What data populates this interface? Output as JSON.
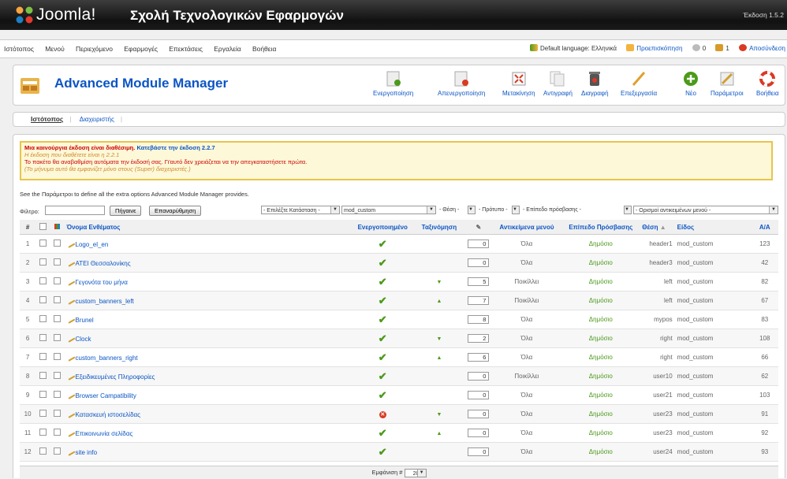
{
  "header": {
    "brand": "Joomla!",
    "site_name": "Σχολή Τεχνολογικών Εφαρμογών",
    "version": "Έκδοση 1.5.2"
  },
  "menubar": [
    "Ιστότοπος",
    "Μενού",
    "Περιεχόμενο",
    "Εφαρμογές",
    "Επεκτάσεις",
    "Εργαλεία",
    "Βοήθεια"
  ],
  "status": {
    "language": "Default language: Ελληνικά",
    "preview": "Προεπισκόπηση",
    "messages": "0",
    "users": "1",
    "logout": "Αποσύνδεση"
  },
  "page_title": "Advanced Module Manager",
  "toolbar": [
    "Ενεργοποίηση",
    "Απενεργοποίηση",
    "Μετακίνηση",
    "Αντιγραφή",
    "Διαγραφή",
    "Επεξεργασία",
    "Νέο",
    "Παράμετροι",
    "Βοήθεια"
  ],
  "submenu": [
    "Ιστότοπος",
    "Διαχειριστής"
  ],
  "notice": {
    "line1a": "Μια καινούργια έκδοση είναι διαθέσιμη.",
    "line1b": "Κατεβάστε την έκδοση 2.2.7",
    "line2": "Η έκδοση που διαθέτετε είναι η 2.2.1",
    "line3": "Το πακέτο θα αναβαθμίση αυτόματα την έκδοσή σας. Γι'αυτό δεν χρειάζεται να την απεγκαταστήσετε πρώτα.",
    "line4": "(Το μήνυμα αυτό θα εμφανίζετ μόνο στους (Super) διαχειριστές.)"
  },
  "intro": "See the Παράμετροι to define all the extra options Advanced Module Manager provides.",
  "filter": {
    "label": "Φίλτρο:",
    "go": "Πήγαινε",
    "reset": "Επαναρύθμηση",
    "state": "- Επιλέξτε Κατάσταση -",
    "type": "mod_custom",
    "position": "- Θέση -",
    "template": "- Πρότυπο -",
    "access": "- Επίπεδο πρόσβασης -",
    "menu": "- Ορισμοί αντικειμένων μενού -"
  },
  "columns": {
    "num": "#",
    "name": "Όνομα Ενθέματος",
    "enabled": "Ενεργοποιημένο",
    "order": "Ταξινόμηση",
    "menu": "Αντικείμενα μενού",
    "access": "Επίπεδο Πρόσβασης",
    "position": "Θέση",
    "type": "Είδος",
    "id": "A/A"
  },
  "rows": [
    {
      "n": "1",
      "name": "Logo_el_en",
      "on": true,
      "up": false,
      "down": false,
      "order": "0",
      "menu": "Όλα",
      "access": "Δημόσιο",
      "pos": "header1",
      "type": "mod_custom",
      "id": "123"
    },
    {
      "n": "2",
      "name": "ATEI Θεσσαλονίκης",
      "on": true,
      "up": false,
      "down": false,
      "order": "0",
      "menu": "Όλα",
      "access": "Δημόσιο",
      "pos": "header3",
      "type": "mod_custom",
      "id": "42"
    },
    {
      "n": "3",
      "name": "Γεγονότα του μήνα",
      "on": true,
      "up": false,
      "down": true,
      "order": "5",
      "menu": "Ποικίλλει",
      "access": "Δημόσιο",
      "pos": "left",
      "type": "mod_custom",
      "id": "82"
    },
    {
      "n": "4",
      "name": "custom_banners_left",
      "on": true,
      "up": true,
      "down": false,
      "order": "7",
      "menu": "Ποικίλλει",
      "access": "Δημόσιο",
      "pos": "left",
      "type": "mod_custom",
      "id": "67"
    },
    {
      "n": "5",
      "name": "Brunel",
      "on": true,
      "up": false,
      "down": false,
      "order": "8",
      "menu": "Όλα",
      "access": "Δημόσιο",
      "pos": "mypos",
      "type": "mod_custom",
      "id": "83"
    },
    {
      "n": "6",
      "name": "Clock",
      "on": true,
      "up": false,
      "down": true,
      "order": "2",
      "menu": "Όλα",
      "access": "Δημόσιο",
      "pos": "right",
      "type": "mod_custom",
      "id": "108"
    },
    {
      "n": "7",
      "name": "custom_banners_right",
      "on": true,
      "up": true,
      "down": false,
      "order": "6",
      "menu": "Όλα",
      "access": "Δημόσιο",
      "pos": "right",
      "type": "mod_custom",
      "id": "66"
    },
    {
      "n": "8",
      "name": "Εξειδικευμένες Πληροφορίες",
      "on": true,
      "up": false,
      "down": false,
      "order": "0",
      "menu": "Ποικίλλει",
      "access": "Δημόσιο",
      "pos": "user10",
      "type": "mod_custom",
      "id": "62"
    },
    {
      "n": "9",
      "name": "Browser Campatibility",
      "on": true,
      "up": false,
      "down": false,
      "order": "0",
      "menu": "Όλα",
      "access": "Δημόσιο",
      "pos": "user21",
      "type": "mod_custom",
      "id": "103"
    },
    {
      "n": "10",
      "name": "Κατασκευή ιστοσελίδας",
      "on": false,
      "up": false,
      "down": true,
      "order": "0",
      "menu": "Όλα",
      "access": "Δημόσιο",
      "pos": "user23",
      "type": "mod_custom",
      "id": "91"
    },
    {
      "n": "11",
      "name": "Επικοινωνία σελίδας",
      "on": true,
      "up": true,
      "down": false,
      "order": "0",
      "menu": "Όλα",
      "access": "Δημόσιο",
      "pos": "user23",
      "type": "mod_custom",
      "id": "92"
    },
    {
      "n": "12",
      "name": "site info",
      "on": true,
      "up": false,
      "down": false,
      "order": "0",
      "menu": "Όλα",
      "access": "Δημόσιο",
      "pos": "user24",
      "type": "mod_custom",
      "id": "93"
    }
  ],
  "footer": {
    "label": "Εμφάνιση #",
    "value": "20"
  }
}
